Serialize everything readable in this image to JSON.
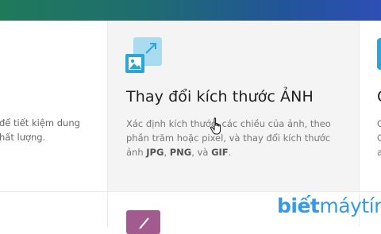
{
  "left_card": {
    "desc_line1": "để tiết kiệm dung",
    "desc_line2": "hất lượng."
  },
  "resize_card": {
    "icon": "resize-image-icon",
    "title": "Thay đổi kích thước ẢNH",
    "desc_part1": "Xác định kích thước, các chiều của ảnh, theo phần trăm hoặc pixel, và thay đổi kích thước ảnh ",
    "fmt_jpg": "JPG",
    "sep1": ", ",
    "fmt_png": "PNG",
    "sep2": ", và ",
    "fmt_gif": "GIF",
    "end": "."
  },
  "right_card": {
    "title_partial": "C",
    "desc_l1": "C",
    "desc_l2": "C",
    "desc_l3": "a"
  },
  "bottom_card": {
    "icon": "edit-image-icon"
  },
  "watermark": {
    "brand_bold": "biết",
    "brand_thin": "máytính"
  },
  "colors": {
    "accent_blue": "#2aa7d8",
    "accent_purple": "#a25a8f",
    "topbar_start": "#1f7a5a",
    "topbar_end": "#2d4fb6"
  }
}
